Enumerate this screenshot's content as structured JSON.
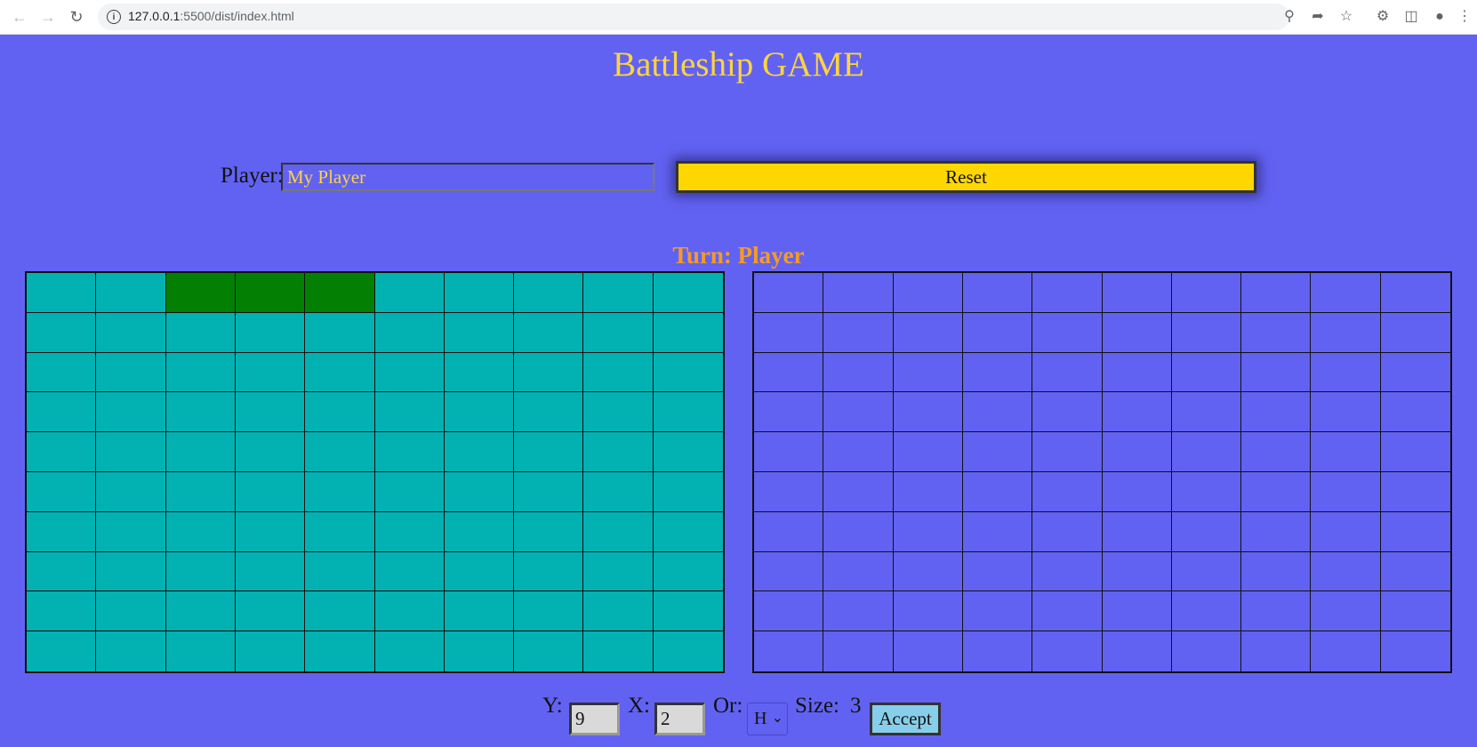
{
  "browser": {
    "url_host": "127.0.0.1",
    "url_rest": ":5500/dist/index.html",
    "icons": [
      "back-icon",
      "forward-icon",
      "reload-icon",
      "site-info-icon",
      "zoom-icon",
      "share-icon",
      "bookmark-star-icon",
      "extensions-icon",
      "side-panel-icon",
      "profile-icon",
      "menu-icon"
    ]
  },
  "header": {
    "title": "Battleship GAME"
  },
  "player": {
    "label": "Player:",
    "value": "My Player"
  },
  "reset_label": "Reset",
  "turn_text": "Turn: Player",
  "own_board": {
    "rows": 10,
    "cols": 10,
    "ship_cells": [
      [
        0,
        2
      ],
      [
        0,
        3
      ],
      [
        0,
        4
      ]
    ],
    "water_color": "#02b2b2",
    "ship_color": "#037f03"
  },
  "enemy_board": {
    "rows": 10,
    "cols": 10,
    "color": "#6262f2"
  },
  "controls": {
    "y_label": "Y:",
    "y_value": "9",
    "x_label": "X:",
    "x_value": "2",
    "or_label": "Or:",
    "or_value": "H",
    "size_label": "Size:",
    "size_value": "3",
    "accept_label": "Accept"
  },
  "colors": {
    "background": "#6262f2",
    "title": "#fcd440",
    "turn": "#f59b25",
    "reset": "#ffd700",
    "accept": "#87ceeb"
  }
}
